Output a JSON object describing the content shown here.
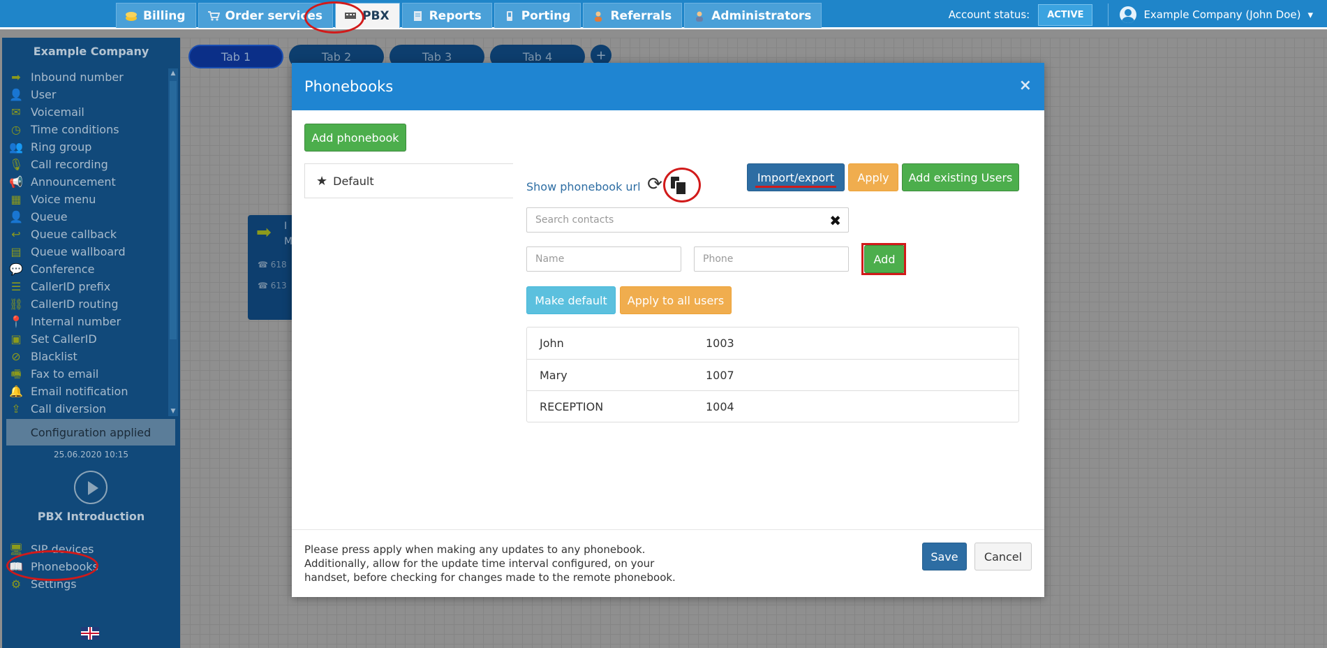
{
  "topbar": {
    "tabs": [
      {
        "label": "Billing",
        "icon": "coins-icon"
      },
      {
        "label": "Order services",
        "icon": "cart-icon"
      },
      {
        "label": "PBX",
        "icon": "pbx-icon",
        "active": true
      },
      {
        "label": "Reports",
        "icon": "notebook-icon"
      },
      {
        "label": "Porting",
        "icon": "phone-icon"
      },
      {
        "label": "Referrals",
        "icon": "person-icon"
      },
      {
        "label": "Administrators",
        "icon": "admin-icon"
      }
    ],
    "account_status_label": "Account status:",
    "account_status_value": "ACTIVE",
    "user_name": "Example Company (John Doe)",
    "user_caret": "▾"
  },
  "sidebar": {
    "company": "Example Company",
    "items": [
      {
        "label": "Inbound number",
        "icon": "arrow-right-icon",
        "glyph": "➡"
      },
      {
        "label": "User",
        "icon": "user-icon",
        "glyph": "👤"
      },
      {
        "label": "Voicemail",
        "icon": "envelope-icon",
        "glyph": "✉"
      },
      {
        "label": "Time conditions",
        "icon": "clock-icon",
        "glyph": "◷"
      },
      {
        "label": "Ring group",
        "icon": "users-icon",
        "glyph": "👥"
      },
      {
        "label": "Call recording",
        "icon": "microphone-icon",
        "glyph": "🎙"
      },
      {
        "label": "Announcement",
        "icon": "megaphone-icon",
        "glyph": "📢"
      },
      {
        "label": "Voice menu",
        "icon": "grid-icon",
        "glyph": "▦"
      },
      {
        "label": "Queue",
        "icon": "user-plus-icon",
        "glyph": "👤"
      },
      {
        "label": "Queue callback",
        "icon": "reply-icon",
        "glyph": "↩"
      },
      {
        "label": "Queue wallboard",
        "icon": "table-icon",
        "glyph": "▤"
      },
      {
        "label": "Conference",
        "icon": "comments-icon",
        "glyph": "💬"
      },
      {
        "label": "CallerID prefix",
        "icon": "list-icon",
        "glyph": "☰"
      },
      {
        "label": "CallerID routing",
        "icon": "sitemap-icon",
        "glyph": "⛓"
      },
      {
        "label": "Internal number",
        "icon": "map-marker-icon",
        "glyph": "📍"
      },
      {
        "label": "Set CallerID",
        "icon": "id-card-icon",
        "glyph": "▣"
      },
      {
        "label": "Blacklist",
        "icon": "ban-icon",
        "glyph": "⊘"
      },
      {
        "label": "Fax to email",
        "icon": "fax-icon",
        "glyph": "🖷"
      },
      {
        "label": "Email notification",
        "icon": "bell-icon",
        "glyph": "🔔"
      },
      {
        "label": "Call diversion",
        "icon": "upload-icon",
        "glyph": "⇪"
      }
    ],
    "config_status": "Configuration applied",
    "config_date": "25.06.2020 10:15",
    "intro_label": "PBX Introduction",
    "bottom_items": [
      {
        "label": "SIP devices",
        "icon": "monitor-icon",
        "glyph": "🖥"
      },
      {
        "label": "Phonebooks",
        "icon": "book-icon",
        "glyph": "📖"
      },
      {
        "label": "Settings",
        "icon": "gear-icon",
        "glyph": "⚙"
      }
    ],
    "language_flag": "uk-flag-icon"
  },
  "canvas": {
    "tabs": [
      "Tab 1",
      "Tab 2",
      "Tab 3",
      "Tab 4"
    ],
    "add_tab": "+",
    "node_lines": [
      "618",
      "613"
    ],
    "node_title": "I",
    "node_sub": "M"
  },
  "modal": {
    "title": "Phonebooks",
    "close": "×",
    "add_phonebook": "Add phonebook",
    "phonebooks": [
      {
        "label": "Default",
        "star": "★"
      }
    ],
    "show_url": "Show phonebook url",
    "refresh_glyph": "⟳",
    "import_export": "Import/export",
    "apply": "Apply",
    "add_existing_users": "Add existing Users",
    "search": {
      "placeholder": "Search contacts"
    },
    "clear_glyph": "✖",
    "name": {
      "placeholder": "Name"
    },
    "phone": {
      "placeholder": "Phone"
    },
    "add": "Add",
    "make_default": "Make default",
    "apply_all": "Apply to all users",
    "contacts": [
      {
        "name": "John",
        "phone": "1003"
      },
      {
        "name": "Mary",
        "phone": "1007"
      },
      {
        "name": "RECEPTION",
        "phone": "1004"
      }
    ],
    "footer_text": "Please press apply when making any updates to any phonebook. Additionally, allow for the update time interval configured, on your handset, before checking for changes made to the remote phonebook.",
    "save": "Save",
    "cancel": "Cancel"
  },
  "colors": {
    "topbar": "#1f85c9",
    "sidebar": "#11497a",
    "modal_header": "#1f85d2",
    "annotation": "#d11a1a",
    "green": "#4cae4c",
    "orange": "#f0ad4e",
    "dark_blue": "#2d6da3",
    "cyan": "#5bc0de"
  }
}
